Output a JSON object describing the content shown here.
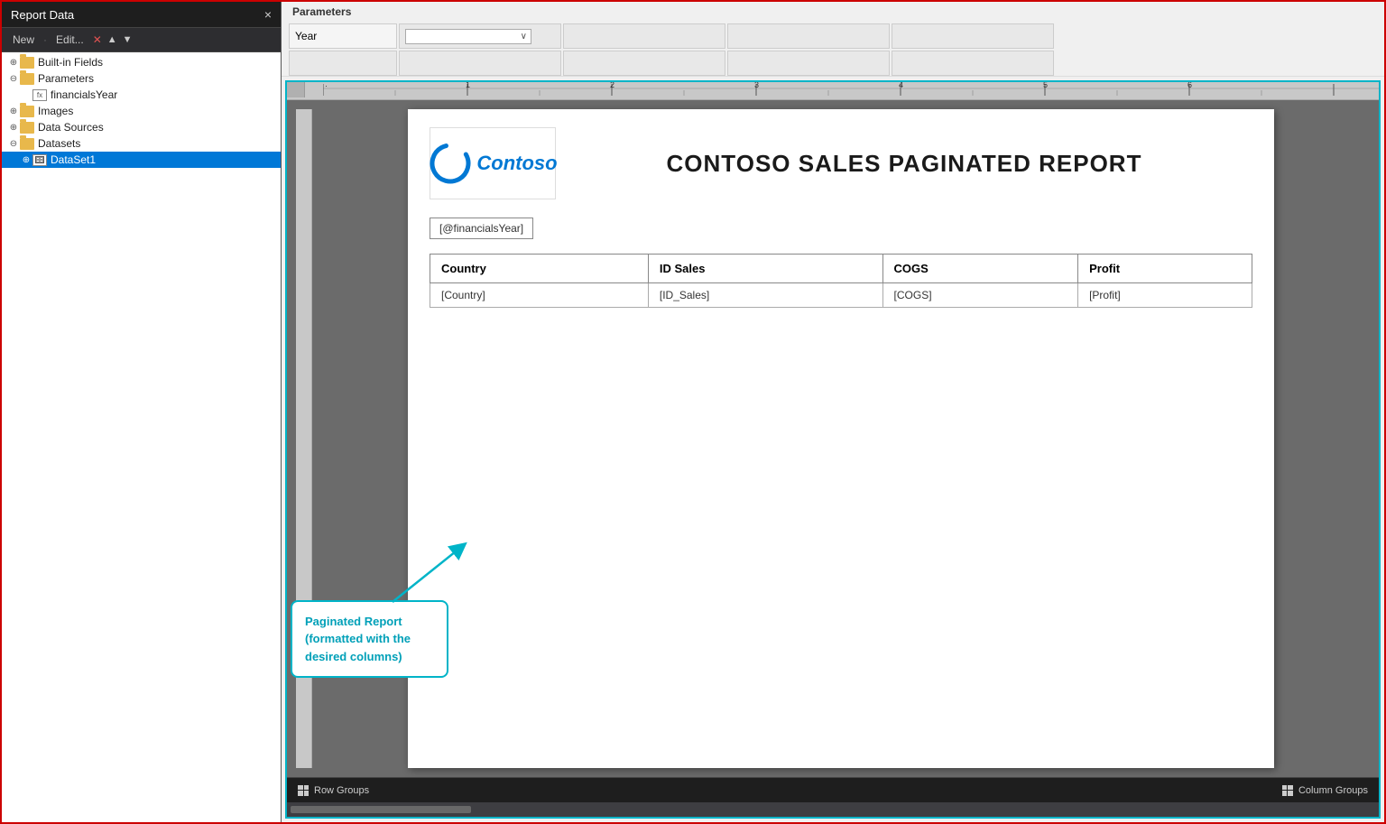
{
  "leftPanel": {
    "title": "Report Data",
    "close": "×",
    "toolbar": {
      "new": "New",
      "separator": "·",
      "edit": "Edit...",
      "delete": "✕",
      "up": "▲",
      "down": "▼"
    },
    "tree": [
      {
        "id": "built-in",
        "label": "Built-in Fields",
        "indent": 0,
        "toggle": "⊕",
        "type": "folder",
        "selected": false
      },
      {
        "id": "parameters",
        "label": "Parameters",
        "indent": 0,
        "toggle": "⊖",
        "type": "folder",
        "selected": false
      },
      {
        "id": "financials-year",
        "label": "financialsYear",
        "indent": 1,
        "toggle": "",
        "type": "param",
        "selected": false
      },
      {
        "id": "images",
        "label": "Images",
        "indent": 0,
        "toggle": "⊕",
        "type": "folder",
        "selected": false
      },
      {
        "id": "data-sources",
        "label": "Data Sources",
        "indent": 0,
        "toggle": "⊕",
        "type": "folder",
        "selected": false
      },
      {
        "id": "datasets",
        "label": "Datasets",
        "indent": 0,
        "toggle": "⊖",
        "type": "folder",
        "selected": false
      },
      {
        "id": "dataset1",
        "label": "DataSet1",
        "indent": 1,
        "toggle": "⊕",
        "type": "dataset",
        "selected": true
      }
    ]
  },
  "paramsBar": {
    "title": "Parameters",
    "yearLabel": "Year",
    "dropdown": {
      "value": "",
      "arrow": "∨"
    },
    "cells": [
      [
        "",
        "",
        "",
        ""
      ],
      [
        "",
        "",
        "",
        ""
      ]
    ]
  },
  "ruler": {
    "ticks": [
      "·",
      "1",
      "·",
      "2",
      "·",
      "3",
      "·",
      "4",
      "·",
      "5",
      "·",
      "6",
      "·"
    ]
  },
  "report": {
    "logoText": "Contoso",
    "title": "CONTOSO SALES PAGINATED REPORT",
    "yearParam": "[@financialsYear]",
    "tableHeaders": [
      "Country",
      "ID Sales",
      "COGS",
      "Profit"
    ],
    "tableRow": [
      "[Country]",
      "[ID_Sales]",
      "[COGS]",
      "[Profit]"
    ]
  },
  "callout": {
    "text": "Paginated Report (formatted with the desired columns)"
  },
  "bottomBar": {
    "rowGroups": "Row Groups",
    "columnGroups": "Column Groups"
  }
}
